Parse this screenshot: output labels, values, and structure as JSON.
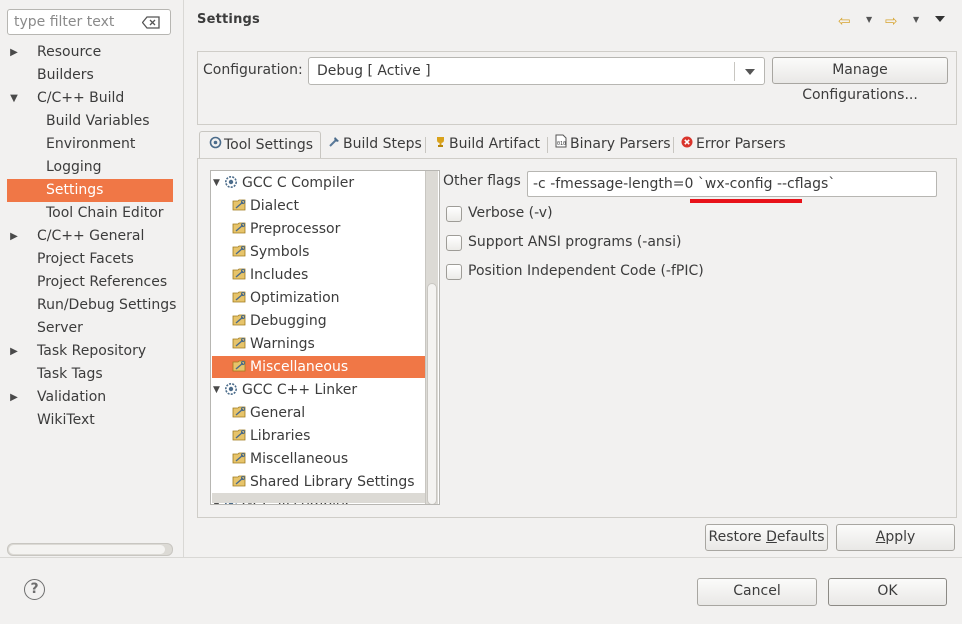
{
  "filter": {
    "placeholder": "type filter text"
  },
  "nav": {
    "items": [
      {
        "label": "Resource",
        "expandable": true,
        "indent": 0
      },
      {
        "label": "Builders",
        "expandable": false,
        "indent": 0
      },
      {
        "label": "C/C++ Build",
        "expandable": true,
        "expanded": true,
        "indent": 0
      },
      {
        "label": "Build Variables",
        "expandable": false,
        "indent": 1
      },
      {
        "label": "Environment",
        "expandable": false,
        "indent": 1
      },
      {
        "label": "Logging",
        "expandable": false,
        "indent": 1
      },
      {
        "label": "Settings",
        "expandable": false,
        "indent": 1,
        "selected": true
      },
      {
        "label": "Tool Chain Editor",
        "expandable": false,
        "indent": 1
      },
      {
        "label": "C/C++ General",
        "expandable": true,
        "indent": 0
      },
      {
        "label": "Project Facets",
        "expandable": false,
        "indent": 0
      },
      {
        "label": "Project References",
        "expandable": false,
        "indent": 0
      },
      {
        "label": "Run/Debug Settings",
        "expandable": false,
        "indent": 0
      },
      {
        "label": "Server",
        "expandable": false,
        "indent": 0
      },
      {
        "label": "Task Repository",
        "expandable": true,
        "indent": 0
      },
      {
        "label": "Task Tags",
        "expandable": false,
        "indent": 0
      },
      {
        "label": "Validation",
        "expandable": true,
        "indent": 0
      },
      {
        "label": "WikiText",
        "expandable": false,
        "indent": 0
      }
    ]
  },
  "page": {
    "title": "Settings"
  },
  "config": {
    "label": "Configuration:",
    "value": "Debug  [ Active ]",
    "manage_label": "Manage Configurations..."
  },
  "tabs": [
    {
      "label": "Tool Settings",
      "icon": "tool-settings-icon",
      "active": true
    },
    {
      "label": "Build Steps",
      "icon": "build-steps-icon"
    },
    {
      "label": "Build Artifact",
      "icon": "build-artifact-icon"
    },
    {
      "label": "Binary Parsers",
      "icon": "binary-parsers-icon"
    },
    {
      "label": "Error Parsers",
      "icon": "error-parsers-icon"
    }
  ],
  "tool_tree": [
    {
      "label": "GCC C Compiler",
      "level": 0,
      "expanded": true
    },
    {
      "label": "Dialect",
      "level": 1
    },
    {
      "label": "Preprocessor",
      "level": 1
    },
    {
      "label": "Symbols",
      "level": 1
    },
    {
      "label": "Includes",
      "level": 1
    },
    {
      "label": "Optimization",
      "level": 1
    },
    {
      "label": "Debugging",
      "level": 1
    },
    {
      "label": "Warnings",
      "level": 1
    },
    {
      "label": "Miscellaneous",
      "level": 1,
      "selected": true
    },
    {
      "label": "GCC C++ Linker",
      "level": 0,
      "expanded": true
    },
    {
      "label": "General",
      "level": 1
    },
    {
      "label": "Libraries",
      "level": 1
    },
    {
      "label": "Miscellaneous",
      "level": 1
    },
    {
      "label": "Shared Library Settings",
      "level": 1
    },
    {
      "label": "GCC Assembler",
      "level": 0,
      "expanded": true
    }
  ],
  "options": {
    "other_flags_label": "Other flags",
    "other_flags_value": "-c -fmessage-length=0 `wx-config --cflags`",
    "checkboxes": [
      {
        "label": "Verbose (-v)",
        "checked": false
      },
      {
        "label": "Support ANSI programs (-ansi)",
        "checked": false
      },
      {
        "label": "Position Independent Code (-fPIC)",
        "checked": false
      }
    ]
  },
  "buttons": {
    "restore_pre": "Restore ",
    "restore_u": "D",
    "restore_post": "efaults",
    "apply_u": "A",
    "apply_post": "pply",
    "cancel": "Cancel",
    "ok": "OK"
  },
  "colors": {
    "selection": "#f07746",
    "annotation_underline": "#e8121a"
  }
}
